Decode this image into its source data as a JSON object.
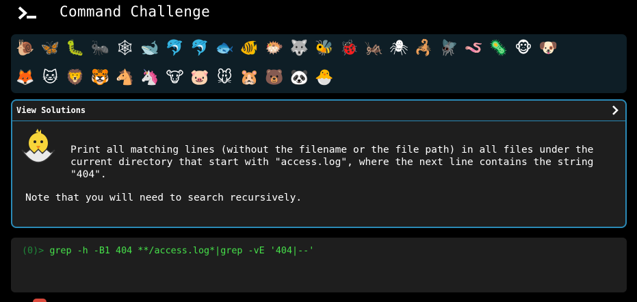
{
  "header": {
    "title": "Command Challenge",
    "logo_icon": "terminal-prompt-icon"
  },
  "emoji_bar": {
    "row1": [
      {
        "name": "snail",
        "glyph": "🐌"
      },
      {
        "name": "butterfly",
        "glyph": "🦋"
      },
      {
        "name": "caterpillar",
        "glyph": "🐛"
      },
      {
        "name": "ant",
        "glyph": "🐜"
      },
      {
        "name": "spider-web",
        "glyph": "🕸"
      },
      {
        "name": "whale",
        "glyph": "🐋"
      },
      {
        "name": "dolphin",
        "glyph": "🐬"
      },
      {
        "name": "dolphin-2",
        "glyph": "🐬"
      },
      {
        "name": "fish",
        "glyph": "🐟"
      },
      {
        "name": "tropical-fish",
        "glyph": "🐠"
      },
      {
        "name": "blowfish",
        "glyph": "🐡"
      },
      {
        "name": "wolf",
        "glyph": "🐺"
      },
      {
        "name": "bee",
        "glyph": "🐝"
      },
      {
        "name": "ladybug",
        "glyph": "🐞"
      },
      {
        "name": "cricket",
        "glyph": "🦗"
      },
      {
        "name": "spider",
        "glyph": "🕷"
      },
      {
        "name": "scorpion",
        "glyph": "🦂"
      },
      {
        "name": "fly",
        "glyph": "🪰"
      },
      {
        "name": "worm",
        "glyph": "🪱"
      },
      {
        "name": "microbe",
        "glyph": "🦠"
      },
      {
        "name": "monkey",
        "glyph": "🐵"
      },
      {
        "name": "dog",
        "glyph": "🐶"
      }
    ],
    "row2": [
      {
        "name": "fox",
        "glyph": "🦊"
      },
      {
        "name": "cat",
        "glyph": "🐱"
      },
      {
        "name": "lion",
        "glyph": "🦁"
      },
      {
        "name": "tiger",
        "glyph": "🐯"
      },
      {
        "name": "horse",
        "glyph": "🐴"
      },
      {
        "name": "unicorn",
        "glyph": "🦄"
      },
      {
        "name": "cow",
        "glyph": "🐮"
      },
      {
        "name": "pig",
        "glyph": "🐷"
      },
      {
        "name": "mouse",
        "glyph": "🐭"
      },
      {
        "name": "hamster",
        "glyph": "🐹"
      },
      {
        "name": "bear",
        "glyph": "🐻"
      },
      {
        "name": "panda",
        "glyph": "🐼"
      },
      {
        "name": "hatching-chick",
        "glyph": "🐣"
      }
    ]
  },
  "challenge": {
    "header_title": "View Solutions",
    "avatar_icon": "hatching-chick-icon",
    "description_lines": [
      "Print all matching lines (without the filename or the file path) in all files under the",
      "current directory that start with \"access.log\", where the next line contains the string",
      "\"404\"."
    ],
    "note": "Note that you will need to search recursively."
  },
  "terminal": {
    "prompt": "(0)> ",
    "command": "grep -h -B1 404 **/access.log*|grep -vE '404|--'"
  },
  "colors": {
    "background": "#000000",
    "emoji_panel": "#0e1e26",
    "card_bg": "#1e1e1e",
    "card_border": "#2a8ab7",
    "prompt": "#1f8a3a",
    "command": "#46e04a"
  }
}
